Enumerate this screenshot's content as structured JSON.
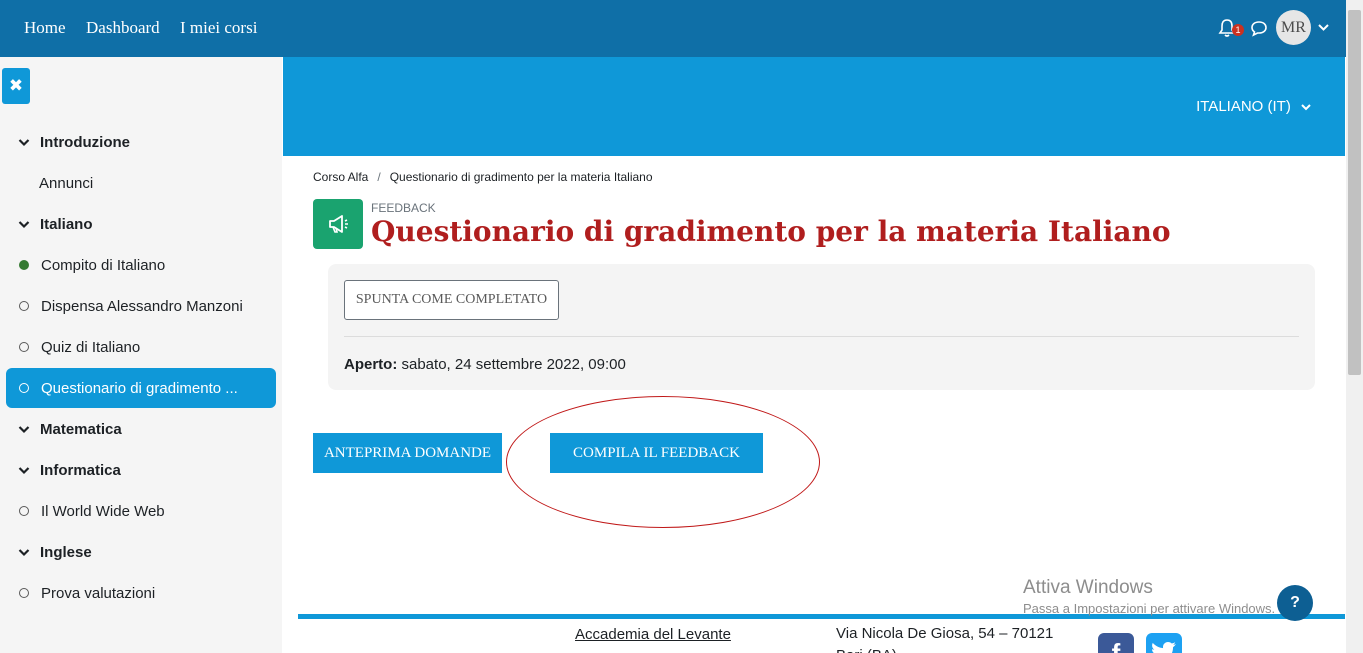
{
  "navbar": {
    "links": [
      "Home",
      "Dashboard",
      "I miei corsi"
    ],
    "notification_count": "1",
    "avatar_initials": "MR"
  },
  "sidebar": {
    "close_icon": "close-icon",
    "items": [
      {
        "label": "Introduzione",
        "kind": "section"
      },
      {
        "label": "Annunci",
        "kind": "plain"
      },
      {
        "label": "Italiano",
        "kind": "section"
      },
      {
        "label": "Compito di Italiano",
        "kind": "activity",
        "status": "complete"
      },
      {
        "label": "Dispensa Alessandro Manzoni",
        "kind": "activity",
        "status": "incomplete"
      },
      {
        "label": "Quiz di Italiano",
        "kind": "activity",
        "status": "incomplete"
      },
      {
        "label": "Questionario di gradimento ...",
        "kind": "activity",
        "status": "incomplete",
        "active": true
      },
      {
        "label": "Matematica",
        "kind": "section"
      },
      {
        "label": "Informatica",
        "kind": "section"
      },
      {
        "label": "Il World Wide Web",
        "kind": "activity",
        "status": "incomplete"
      },
      {
        "label": "Inglese",
        "kind": "section"
      },
      {
        "label": "Prova valutazioni",
        "kind": "activity",
        "status": "incomplete"
      }
    ]
  },
  "header": {
    "language": "ITALIANO (IT)"
  },
  "breadcrumb": [
    "Corso Alfa",
    "Questionario di gradimento per la materia Italiano"
  ],
  "activity": {
    "type": "FEEDBACK",
    "icon": "megaphone-icon",
    "title": "Questionario di gradimento per la materia Italiano",
    "complete_button": "SPUNTA COME COMPLETATO",
    "open_label": "Aperto:",
    "open_value": "sabato, 24 settembre 2022, 09:00"
  },
  "actions": {
    "preview": "ANTEPRIMA DOMANDE",
    "fill": "COMPILA IL FEEDBACK"
  },
  "footer": {
    "org_link": "Accademia del Levante",
    "address_line1": "Via Nicola De Giosa, 54 – 70121",
    "address_line2": "Bari (BA)"
  },
  "watermark": {
    "title": "Attiva Windows",
    "subtitle": "Passa a Impostazioni per attivare Windows."
  },
  "help": "?",
  "colors": {
    "navbar": "#0f6fa7",
    "accent": "#0f98d8",
    "title": "#b01e1e",
    "feedback_icon_bg": "#1aa36f"
  }
}
